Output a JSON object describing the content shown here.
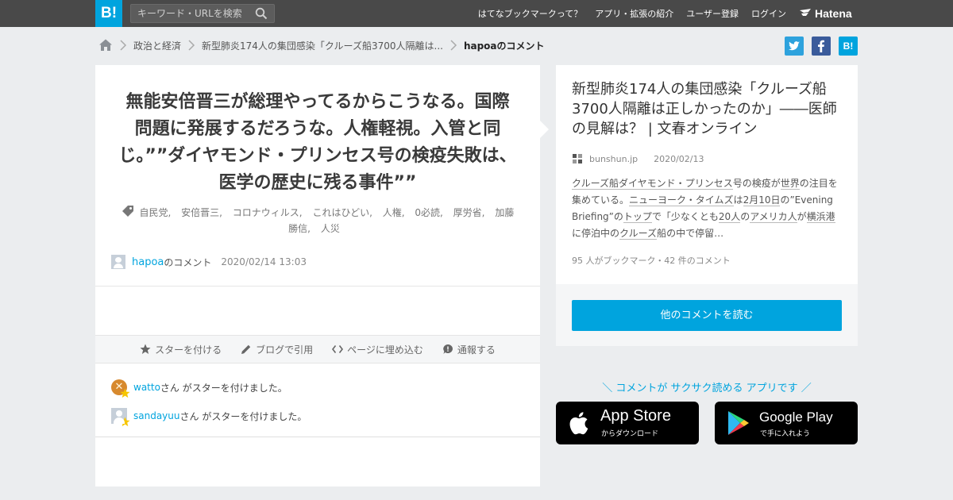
{
  "header": {
    "logo": "B!",
    "search_placeholder": "キーワード・URLを検索",
    "nav": [
      "はてなブックマークって？",
      "アプリ・拡張の紹介",
      "ユーザー登録",
      "ログイン"
    ],
    "brand": "Hatena"
  },
  "breadcrumb": {
    "items": [
      "政治と経済",
      "新型肺炎174人の集団感染「クルーズ船3700人隔離は..."
    ],
    "current": "hapoaのコメント"
  },
  "share": {
    "twitter": "t",
    "facebook": "f",
    "hatena": "B!"
  },
  "comment": {
    "text": "無能安倍晋三が総理やってるからこうなる。国際問題に発展するだろうな。人権軽視。入管と同じ。””ダイヤモンド・プリンセス号の検疫失敗は、医学の歴史に残る事件””",
    "tags": [
      "自民党,",
      "安倍晋三,",
      "コロナウィルス,",
      "これはひどい,",
      "人権,",
      "0必読,",
      "厚労省,",
      "加藤勝信,",
      "人災"
    ],
    "user": "hapoa",
    "user_suffix": "のコメント",
    "date": "2020/02/14 13:03"
  },
  "actions": {
    "star": "スターを付ける",
    "blog": "ブログで引用",
    "embed": "ページに埋め込む",
    "report": "通報する"
  },
  "stars": [
    {
      "user": "watto",
      "text": "さん がスターを付けました。"
    },
    {
      "user": "sandayuu",
      "text": "さん がスターを付けました。"
    }
  ],
  "entry": {
    "title": "新型肺炎174人の集団感染「クルーズ船3700人隔離は正しかったのか」――医師の見解は？ | 文春オンライン",
    "domain": "bunshun.jp",
    "date": "2020/02/13",
    "summary": {
      "s1": "クルーズ船",
      "s2": "ダイヤモンド・プリンセス",
      "s3": "号の検疫が",
      "s4": "世界",
      "s5": "の注目を集めている。",
      "s6": "ニューヨーク・タイムズ",
      "s7": "は",
      "s8": "2月10日",
      "s9": "の”Evening Briefing”の",
      "s10": "トップ",
      "s11": "で「少なくとも",
      "s12": "20人",
      "s13": "の",
      "s14": "アメリカ人",
      "s15": "が",
      "s16": "横浜港",
      "s17": "に停泊中の",
      "s18": "クルーズ",
      "s19": "船の中で停留…"
    },
    "counts": "95 人がブックマーク・42 件のコメント",
    "read_more": "他のコメントを読む"
  },
  "app_promo": {
    "text": "＼ コメントが サクサク読める アプリです ／",
    "app_store": {
      "name": "App Store",
      "sub": "からダウンロード"
    },
    "google_play": {
      "name": "Google Play",
      "sub": "で手に入れよう"
    }
  },
  "colors": {
    "accent": "#00a4de",
    "topbar": "#494949",
    "background": "#ebedef"
  }
}
